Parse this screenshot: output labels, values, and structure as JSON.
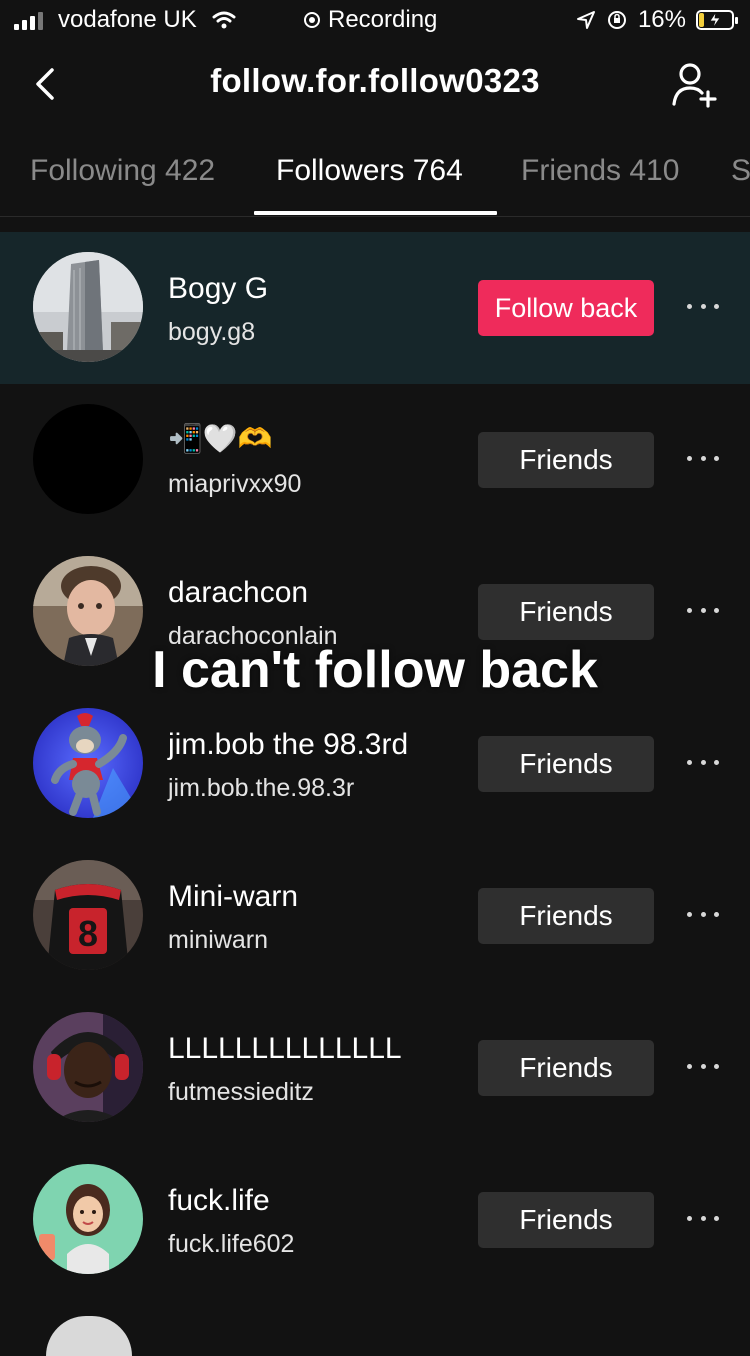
{
  "status_bar": {
    "carrier": "vodafone UK",
    "recording": "Recording",
    "battery": "16%",
    "battery_level": 0.16
  },
  "header": {
    "title": "follow.for.follow0323",
    "back_icon": "chevron-left-icon",
    "add_icon": "add-user-icon"
  },
  "tabs": [
    {
      "label": "Following 422"
    },
    {
      "label": "Followers 764",
      "active": true
    },
    {
      "label": "Friends 410"
    },
    {
      "label": "S"
    }
  ],
  "followers": [
    {
      "name": "Bogy G",
      "handle": "bogy.g8",
      "button": "Follow back"
    },
    {
      "name": "📲🤍🫶",
      "handle": "miaprivxx90",
      "button": "Friends"
    },
    {
      "name": "darachcon",
      "handle": "darachoconlain",
      "button": "Friends"
    },
    {
      "name": "jim.bob the 98.3rd",
      "handle": "jim.bob.the.98.3r",
      "button": "Friends"
    },
    {
      "name": "Mini-warn",
      "handle": "miniwarn",
      "button": "Friends"
    },
    {
      "name": "LLLLLLLLLLLLLL",
      "handle": "futmessieditz",
      "button": "Friends"
    },
    {
      "name": "fuck.life",
      "handle": "fuck.life602",
      "button": "Friends"
    }
  ],
  "overlay_caption": "I can't follow back",
  "jersey_number": "8"
}
